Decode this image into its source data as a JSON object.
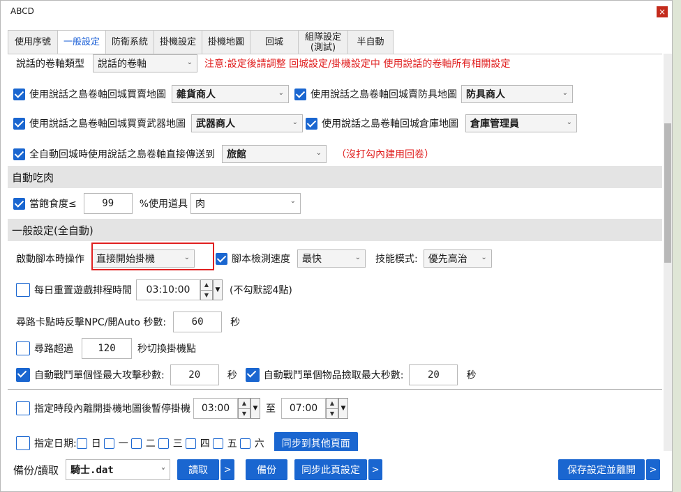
{
  "window": {
    "title": "ABCD",
    "close": "×"
  },
  "tabs": [
    {
      "label": "使用序號",
      "active": false
    },
    {
      "label": "一般設定",
      "active": true
    },
    {
      "label": "防衛系統",
      "active": false
    },
    {
      "label": "掛機設定",
      "active": false
    },
    {
      "label": "掛機地圖",
      "active": false
    },
    {
      "label": "回城",
      "active": false
    },
    {
      "label": "組隊設定\n(測試)",
      "active": false
    },
    {
      "label": "半自動",
      "active": false
    }
  ],
  "scroll_type": {
    "label": "說話的卷軸類型",
    "value": "說話的卷軸",
    "note": "注意:設定後請調整 回城設定/掛機設定中 使用說話的卷軸所有相關設定"
  },
  "scroll_opts": {
    "sell_misc_label": "使用說話之島卷軸回城買賣地圖",
    "sell_misc_value": "雜貨商人",
    "sell_armor_label": "使用說話之島卷軸回城賣防具地圖",
    "sell_armor_value": "防具商人",
    "sell_weapon_label": "使用說話之島卷軸回城買賣武器地圖",
    "sell_weapon_value": "武器商人",
    "warehouse_label": "使用說話之島卷軸回城倉庫地圖",
    "warehouse_value": "倉庫管理員",
    "teleport_label": "全自動回城時使用說話之島卷軸直接傳送到",
    "teleport_value": "旅館",
    "teleport_note": "（沒打勾內建用回卷）"
  },
  "auto_eat": {
    "header": "自動吃肉",
    "label": "當飽食度≤",
    "value": "99",
    "label2": "%使用道具",
    "item": "肉"
  },
  "general": {
    "header": "一般設定(全自動)",
    "start_label": "啟動腳本時操作",
    "start_value": "直接開始掛機",
    "detect_label": "腳本檢測速度",
    "detect_value": "最快",
    "skill_label": "技能模式:",
    "skill_value": "優先高治",
    "reset_label": "每日重置遊戲排程時間",
    "reset_time": "03:10:00",
    "reset_note": "(不勾默認4點)",
    "stuck_label": "尋路卡點時反擊NPC/開Auto 秒數:",
    "stuck_value": "60",
    "stuck_unit": "秒",
    "path_label": "尋路超過",
    "path_value": "120",
    "path_unit": "秒切換掛機點",
    "monster_label": "自動戰鬥單個怪最大攻擊秒數:",
    "monster_value": "20",
    "monster_unit": "秒",
    "item_label": "自動戰鬥單個物品撿取最大秒數:",
    "item_value": "20",
    "item_unit": "秒",
    "period_label": "指定時段內離開掛機地圖後暫停掛機",
    "period_from": "03:00",
    "period_to_label": "至",
    "period_to": "07:00",
    "date_label": "指定日期:",
    "days": [
      "日",
      "一",
      "二",
      "三",
      "四",
      "五",
      "六"
    ],
    "sync_button": "同步到其他頁面"
  },
  "bottom": {
    "backup_label": "備份/讀取",
    "file_value": "騎士.dat",
    "read_button": "讀取",
    "arrow": ">",
    "backup_button": "備份",
    "sync_button": "同步此頁設定",
    "save_button": "保存設定並離開"
  },
  "colors": {
    "accent": "#1a66d0",
    "warning": "#e02020",
    "section_bg": "#e4e4e4"
  }
}
